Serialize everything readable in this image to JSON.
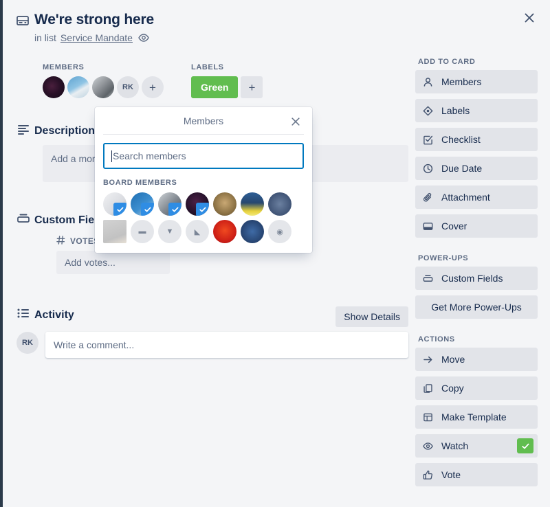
{
  "window": {
    "close_label": "×"
  },
  "card": {
    "icon": "card-icon",
    "title": "We're strong here",
    "in_list_prefix": "in list",
    "list_name": "Service Mandate",
    "watch_eye_icon": "eye-icon"
  },
  "members_strip": {
    "heading": "MEMBERS",
    "avatars": [
      {
        "name": "member-avatar-1",
        "color": "#22102a",
        "initials": ""
      },
      {
        "name": "member-avatar-2",
        "color": "#5aa0cf",
        "initials": ""
      },
      {
        "name": "member-avatar-3",
        "color": "#8d9196",
        "initials": ""
      },
      {
        "name": "member-avatar-4",
        "color": "#dfe1e6",
        "initials": "RK"
      }
    ],
    "add_label": "+"
  },
  "labels_strip": {
    "heading": "LABELS",
    "chips": [
      {
        "label": "Green",
        "color": "#61bd4f"
      }
    ],
    "add_label": "+"
  },
  "description": {
    "icon": "description-icon",
    "title": "Description",
    "placeholder": "Add a more detailed description..."
  },
  "custom_fields": {
    "icon": "custom-fields-icon",
    "title": "Custom Fields",
    "votes_icon": "hash-icon",
    "votes_label": "VOTES",
    "votes_placeholder": "Add votes..."
  },
  "activity": {
    "icon": "activity-icon",
    "title": "Activity",
    "show_details_label": "Show Details",
    "commenter_initials": "RK",
    "comment_placeholder": "Write a comment..."
  },
  "popover": {
    "title": "Members",
    "close_label": "×",
    "search_placeholder": "Search members",
    "search_value": "",
    "board_members_label": "BOARD MEMBERS",
    "avatars": [
      {
        "name": "board-member-1",
        "color": "#e8e9ec",
        "selected": true,
        "broken": false,
        "glyph": ""
      },
      {
        "name": "board-member-2",
        "color": "#2b6ca3",
        "selected": true,
        "broken": false,
        "glyph": ""
      },
      {
        "name": "board-member-3",
        "color": "#9aa2ad",
        "selected": true,
        "broken": false,
        "glyph": ""
      },
      {
        "name": "board-member-4",
        "color": "#2a1530",
        "selected": true,
        "broken": false,
        "glyph": ""
      },
      {
        "name": "board-member-5",
        "color": "#9d8052",
        "selected": false,
        "broken": false,
        "glyph": ""
      },
      {
        "name": "board-member-6",
        "color": "#3b6ea8",
        "selected": false,
        "broken": false,
        "glyph": ""
      },
      {
        "name": "board-member-7",
        "color": "#4a6285",
        "selected": false,
        "broken": false,
        "glyph": ""
      },
      {
        "name": "board-member-8",
        "color": "#c9c9c9",
        "selected": false,
        "broken": true,
        "glyph": ""
      },
      {
        "name": "board-member-9",
        "color": "#e4e6ea",
        "selected": false,
        "broken": false,
        "glyph": "▬"
      },
      {
        "name": "board-member-10",
        "color": "#e4e6ea",
        "selected": false,
        "broken": false,
        "glyph": "▼"
      },
      {
        "name": "board-member-11",
        "color": "#e4e6ea",
        "selected": false,
        "broken": false,
        "glyph": "◣"
      },
      {
        "name": "board-member-12",
        "color": "#d62f20",
        "selected": false,
        "broken": false,
        "glyph": ""
      },
      {
        "name": "board-member-13",
        "color": "#2e5c96",
        "selected": false,
        "broken": false,
        "glyph": ""
      },
      {
        "name": "board-member-14",
        "color": "#e4e6ea",
        "selected": false,
        "broken": false,
        "glyph": "◉"
      }
    ]
  },
  "sidebar": {
    "add_to_card_heading": "ADD TO CARD",
    "add_to_card": [
      {
        "label": "Members",
        "icon": "person-icon"
      },
      {
        "label": "Labels",
        "icon": "label-icon"
      },
      {
        "label": "Checklist",
        "icon": "checkbox-icon"
      },
      {
        "label": "Due Date",
        "icon": "clock-icon"
      },
      {
        "label": "Attachment",
        "icon": "paperclip-icon"
      },
      {
        "label": "Cover",
        "icon": "cover-icon"
      }
    ],
    "power_ups_heading": "POWER-UPS",
    "power_ups": [
      {
        "label": "Custom Fields",
        "icon": "custom-fields-icon",
        "centered": false
      },
      {
        "label": "Get More Power-Ups",
        "icon": "",
        "centered": true
      }
    ],
    "actions_heading": "ACTIONS",
    "actions": [
      {
        "label": "Move",
        "icon": "arrow-right-icon",
        "badge": false
      },
      {
        "label": "Copy",
        "icon": "copy-icon",
        "badge": false
      },
      {
        "label": "Make Template",
        "icon": "template-icon",
        "badge": false
      },
      {
        "label": "Watch",
        "icon": "eye-icon",
        "badge": true
      },
      {
        "label": "Vote",
        "icon": "thumbs-up-icon",
        "badge": false
      }
    ]
  },
  "colors": {
    "accent": "#0079bf",
    "green": "#61bd4f",
    "text": "#172b4d",
    "muted": "#5e6c84"
  }
}
